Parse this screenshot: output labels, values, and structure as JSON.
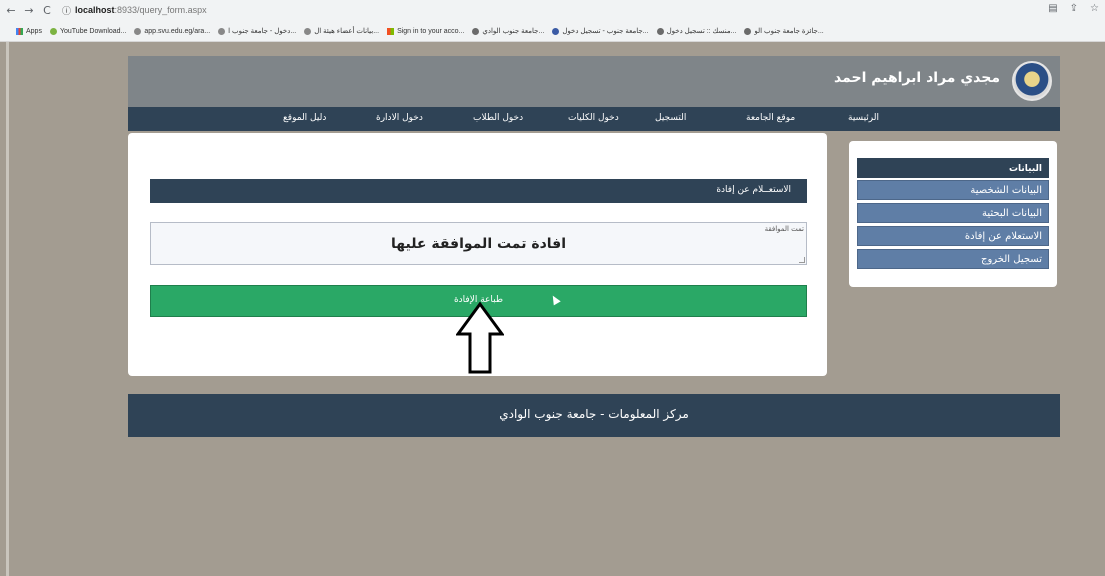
{
  "browser": {
    "nav_back": "←",
    "nav_forward": "→",
    "reload": "C",
    "info_icon": "ⓘ",
    "url_host": "localhost",
    "url_path": ":8933/query_form.aspx",
    "right_icons": [
      "▤",
      "⇪",
      "☆"
    ]
  },
  "bookmarks": [
    {
      "label": "Apps",
      "icon": "apps-icon"
    },
    {
      "label": "YouTube Download...",
      "icon": "youtube-download-icon"
    },
    {
      "label": "app.svu.edu.eg/ara...",
      "icon": "globe-icon"
    },
    {
      "label": "دخول - جامعة جنوب ا...",
      "icon": "globe-icon"
    },
    {
      "label": "بيانات أعضاء هيئة ال...",
      "icon": "globe-icon"
    },
    {
      "label": "Sign in to your acco...",
      "icon": "microsoft-icon"
    },
    {
      "label": "جامعة جنوب الوادي...",
      "icon": "university-icon"
    },
    {
      "label": "جامعة جنوب - تسجيل دخول...",
      "icon": "blue-icon"
    },
    {
      "label": "منسك :: تسجيل دخول...",
      "icon": "university-icon"
    },
    {
      "label": "جائزة جامعة جنوب الو...",
      "icon": "university-icon"
    }
  ],
  "header": {
    "user_name": "مجدي مراد ابراهيم احمد"
  },
  "nav": {
    "home": "الرئيسية",
    "university_site": "موقع الجامعة",
    "registration": "التسجيل",
    "faculties_login": "دخول الكليات",
    "students_login": "دخول الطلاب",
    "admin_login": "دخول الادارة",
    "site_guide": "دليل الموقع"
  },
  "main": {
    "inquiry_title": "الاستعــلام عن إفادة",
    "result_label": "تمت الموافقة",
    "result_text": "افادة تمت الموافقة عليها",
    "print_label": "طباعة الإفادة"
  },
  "sidebar": {
    "head": "البيانات",
    "items": [
      {
        "label": "البيانات الشخصية"
      },
      {
        "label": "البيانات البحثية"
      },
      {
        "label": "الاستعلام عن إفادة"
      },
      {
        "label": "تسجيل الخروج"
      }
    ]
  },
  "footer": {
    "text": "مركز المعلومات - جامعة جنوب الوادي"
  },
  "colors": {
    "page_bg": "#a39c91",
    "header_bg": "#7f8589",
    "nav_bg": "#2f4356",
    "print_button": "#2aa866",
    "sidebar_item": "#5f7ea6"
  }
}
